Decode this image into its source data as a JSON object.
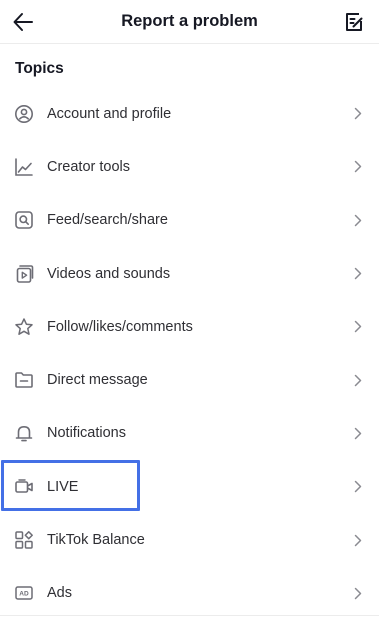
{
  "header": {
    "title": "Report a problem",
    "back_icon": "arrow-left-icon",
    "action_icon": "edit-note-icon"
  },
  "section": {
    "title": "Topics"
  },
  "topics": [
    {
      "label": "Account and profile",
      "icon": "user-circle-icon"
    },
    {
      "label": "Creator tools",
      "icon": "line-chart-icon"
    },
    {
      "label": "Feed/search/share",
      "icon": "search-square-icon"
    },
    {
      "label": "Videos and sounds",
      "icon": "video-play-icon"
    },
    {
      "label": "Follow/likes/comments",
      "icon": "star-icon"
    },
    {
      "label": "Direct message",
      "icon": "message-folder-icon"
    },
    {
      "label": "Notifications",
      "icon": "bell-icon"
    },
    {
      "label": "LIVE",
      "icon": "live-camera-icon"
    },
    {
      "label": "TikTok Balance",
      "icon": "grid-apps-icon"
    },
    {
      "label": "Ads",
      "icon": "ad-badge-icon"
    }
  ],
  "highlighted_item": "LIVE",
  "colors": {
    "text": "#161823",
    "muted_icon": "#6d6d75",
    "highlight_border": "#4470e6",
    "divider": "#ececec"
  }
}
